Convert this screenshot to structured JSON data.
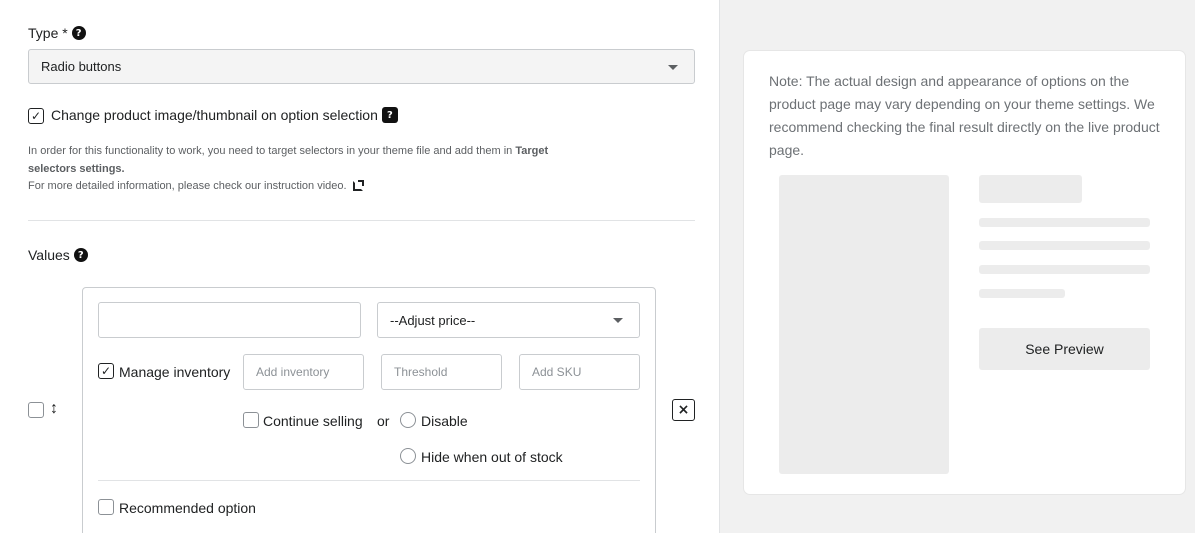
{
  "type_field": {
    "label": "Type *",
    "selected": "Radio buttons"
  },
  "change_image": {
    "label": "Change product image/thumbnail on option selection",
    "checked": true,
    "help_text_prefix": "In order for this functionality to work, you need to target selectors in your theme file and add them in ",
    "help_link_1": "Target",
    "help_link_2": "selectors settings.",
    "video_text": "For more detailed information, please check our instruction video."
  },
  "values": {
    "label": "Values",
    "value_input": "",
    "adjust_price": "--Adjust price--",
    "manage_inventory_label": "Manage inventory",
    "manage_inventory_checked": true,
    "inventory_placeholder": "Add inventory",
    "threshold_placeholder": "Threshold",
    "sku_placeholder": "Add SKU",
    "continue_selling_label": "Continue selling",
    "or_label": "or",
    "disable_label": "Disable",
    "hide_label": "Hide when out of stock",
    "recommended_label": "Recommended option",
    "remove_icon": "×",
    "drag_icon": "↕"
  },
  "preview": {
    "note": "Note: The actual design and appearance of options on the product page may vary depending on your theme settings. We recommend checking the final result directly on the live product page.",
    "button": "See Preview"
  },
  "colors": {
    "background": "#f1f1f1",
    "border": "#c9cccf",
    "text": "#202223",
    "muted": "#6d7175",
    "placeholder": "#ececec"
  }
}
